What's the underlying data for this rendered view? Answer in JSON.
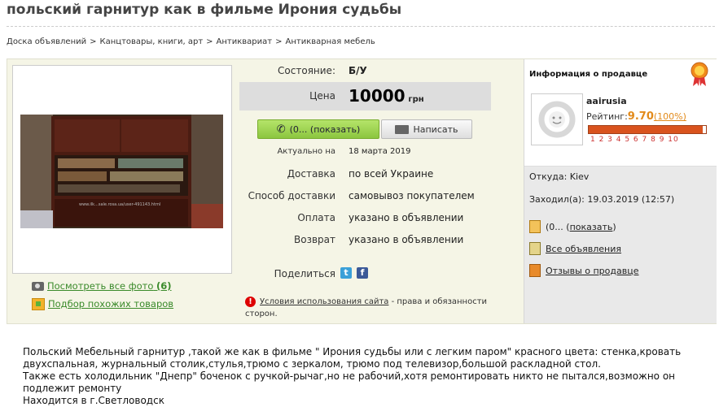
{
  "title": "польский гарнитур как в фильме Ирония судьбы",
  "breadcrumbs": [
    "Доска объявлений",
    "Канцтовары, книги, арт",
    "Антиквариат",
    "Антикварная мебель"
  ],
  "breadcrumb_sep": ">",
  "photo": {
    "watermark": "www.ilk...sale.rosa.ua/user-491143.html"
  },
  "links": {
    "all_photos": "Посмотреть все фото",
    "all_photos_count": "(6)",
    "similar": "Подбор похожих товаров"
  },
  "details": {
    "state_label": "Состояние:",
    "state_value": "Б/У",
    "price_label": "Цена",
    "price_value": "10000",
    "price_currency": "грн",
    "call_button": "(0... (показать)",
    "write_button": "Написать",
    "actual_label": "Актуально на",
    "actual_value": "18 марта 2019",
    "delivery_label": "Доставка",
    "delivery_value": "по всей Украине",
    "delivery_method_label": "Способ доставки",
    "delivery_method_value": "самовывоз покупателем",
    "payment_label": "Оплата",
    "payment_value": "указано в объявлении",
    "return_label": "Возврат",
    "return_value": "указано в объявлении",
    "share_label": "Поделиться",
    "terms_link": "Условия использования сайта",
    "terms_text": " - права и обязанности сторон."
  },
  "seller": {
    "header": "Информация о продавце",
    "name": "aairusia",
    "rating_label": "Рейтинг:",
    "rating_value": "9.70",
    "rating_percent": "(100%)",
    "rating_fraction": 0.97,
    "rating_scale": "1 2 3 4 5 6 7 8 9 10",
    "from": "Откуда: Kiev",
    "visited": "Заходил(а): 19.03.2019 (12:57)",
    "phone_prefix": "(0... (",
    "phone_link": "показать",
    "phone_suffix": ")",
    "all_ads": "Все объявления",
    "reviews": "Отзывы о продавце"
  },
  "description": " Польский Мебельный гарнитур ,такой же как в фильме \" Ирония судьбы или с легким паром\" красного цвета: стенка,кровать двухспальная, журнальный столик,стулья,трюмо с зеркалом, трюмо под телевизор,большой раскладной стол.\nТакже есть холодильник \"Днепр\" боченок с ручкой-рычаг,но не рабочий,хотя ремонтировать никто не пытался,возможно он подлежит ремонту\nНаходится в г.Светловодск"
}
